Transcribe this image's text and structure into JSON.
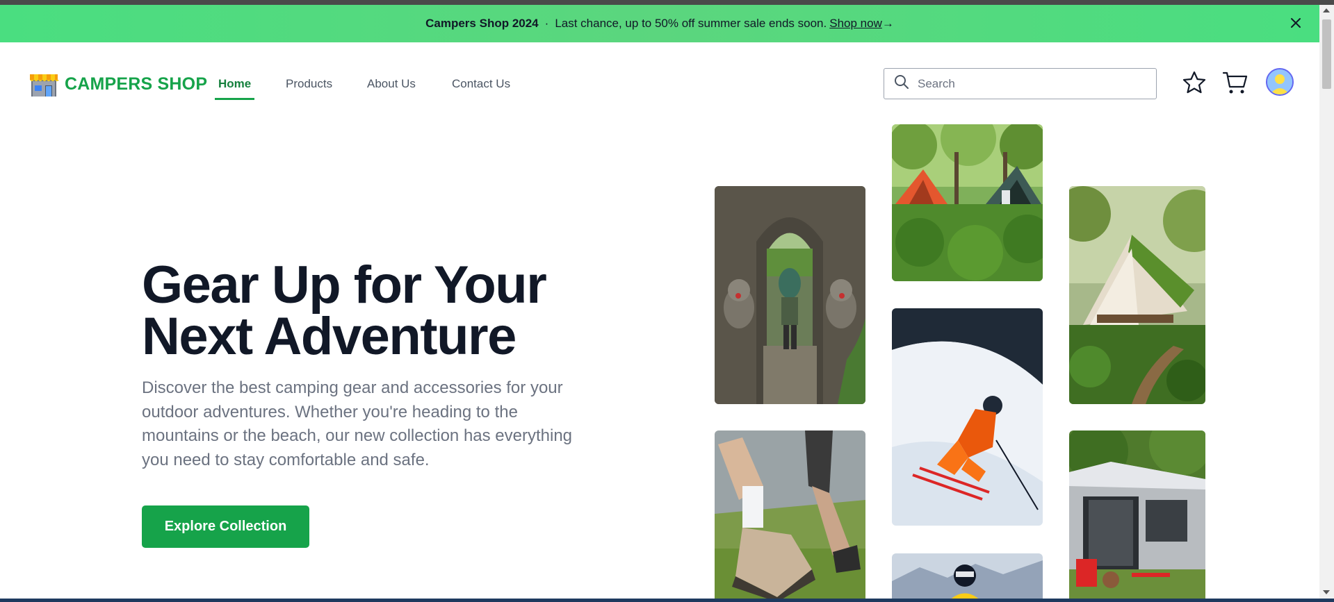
{
  "banner": {
    "brand": "Campers Shop 2024",
    "separator": "·",
    "message": "Last chance, up to 50% off summer sale ends soon.",
    "link_label": " Shop now",
    "link_arrow": "→"
  },
  "header": {
    "logo_text": "CAMPERS SHOP",
    "nav": [
      {
        "label": "Home",
        "active": true
      },
      {
        "label": "Products",
        "active": false
      },
      {
        "label": "About Us",
        "active": false
      },
      {
        "label": "Contact Us",
        "active": false
      }
    ],
    "search": {
      "placeholder": "Search",
      "value": ""
    },
    "icons": [
      "star-icon",
      "cart-icon",
      "user-avatar"
    ]
  },
  "hero": {
    "title_line1": "Gear Up for Your",
    "title_line2": "Next Adventure",
    "description": "Discover the best camping gear and accessories for your outdoor adventures. Whether you're heading to the mountains or the beach, our new collection has everything you need to stay comfortable and safe.",
    "cta_label": "Explore Collection"
  },
  "colors": {
    "brand_green": "#16a34a",
    "banner_green": "#4ade80",
    "heading": "#111827",
    "body_text": "#6b7280"
  }
}
